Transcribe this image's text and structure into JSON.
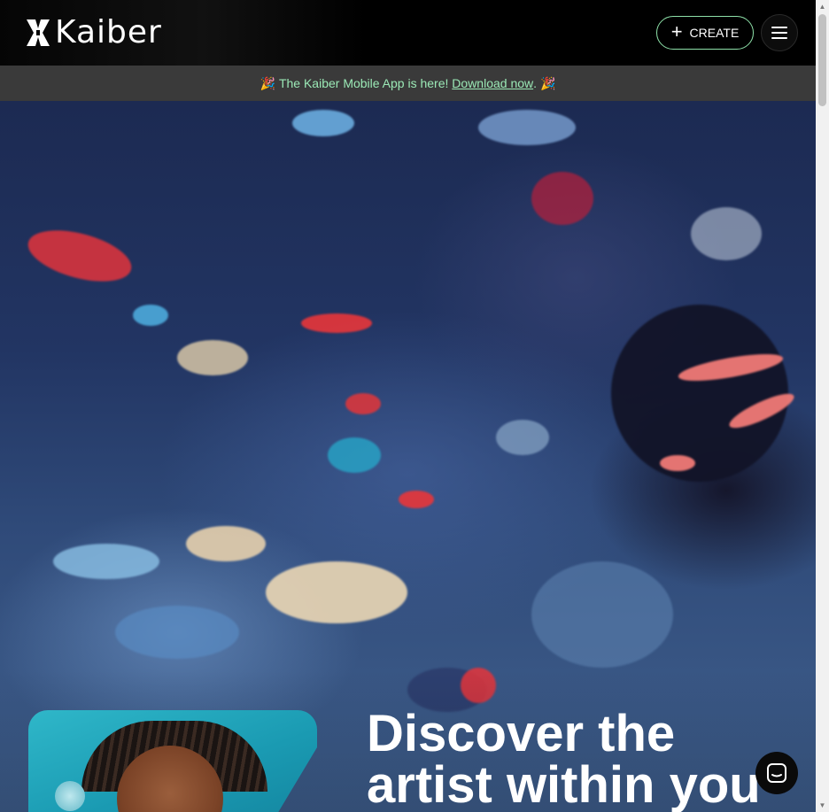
{
  "header": {
    "logo_text": "Kaiber",
    "create_label": "CREATE",
    "plus_icon": "+",
    "menu_icon": "hamburger-menu-icon"
  },
  "announcement": {
    "emoji": "🎉",
    "text": "The Kaiber Mobile App is here!",
    "link_text": "Download now",
    "suffix": "."
  },
  "hero": {
    "title_line1": "Discover the",
    "title_line2": "artist within you"
  },
  "chat": {
    "icon": "chat-icon"
  },
  "colors": {
    "accent": "#8de0a8",
    "announce_bg": "#3a3a3a",
    "announce_text": "#9be9b6"
  }
}
